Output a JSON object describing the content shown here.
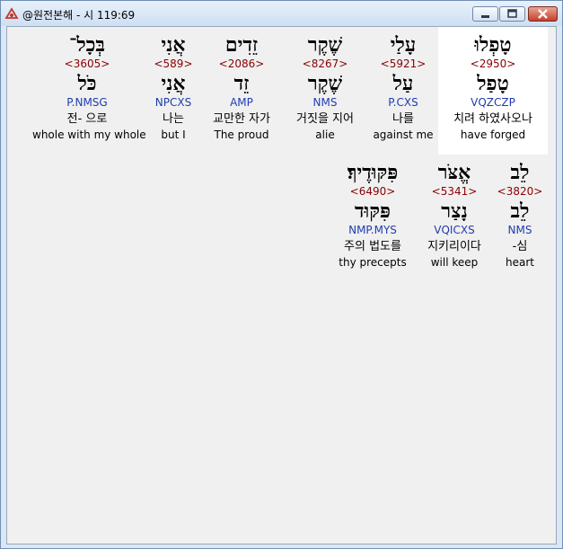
{
  "window": {
    "title": "@원전본해 - 시 119:69"
  },
  "rows": [
    [
      {
        "hebrew": "טָפְלוּ",
        "strong": "<2950>",
        "lemma": "טָפַל",
        "parsing": "VQZCZP",
        "korean": "치려 하였사오나",
        "english": "have forged",
        "selected": true
      },
      {
        "hebrew": "עָלַי",
        "strong": "<5921>",
        "lemma": "עַל",
        "parsing": "P.CXS",
        "korean": "나를",
        "english": "against me",
        "selected": false
      },
      {
        "hebrew": "שֶׁקֶר",
        "strong": "<8267>",
        "lemma": "שֶׁקֶר",
        "parsing": "NMS",
        "korean": "거짓을 지어",
        "english": "alie",
        "selected": false
      },
      {
        "hebrew": "זֵדִים",
        "strong": "<2086>",
        "lemma": "זֵד",
        "parsing": "AMP",
        "korean": "교만한 자가",
        "english": "The proud",
        "selected": false
      },
      {
        "hebrew": "אֲנִי",
        "strong": "<589>",
        "lemma": "אֲנִי",
        "parsing": "NPCXS",
        "korean": "나는",
        "english": "but I",
        "selected": false
      },
      {
        "hebrew": "בְּכָל־",
        "strong": "<3605>",
        "lemma": "כֹּל",
        "parsing": "P.NMSG",
        "korean": "전- 으로",
        "english": "whole with my whole",
        "selected": false
      }
    ],
    [
      {
        "hebrew": "לֵב",
        "strong": "<3820>",
        "lemma": "לֵב",
        "parsing": "NMS",
        "korean": "-심",
        "english": "heart",
        "selected": false
      },
      {
        "hebrew": "אֱצֹּר",
        "strong": "<5341>",
        "lemma": "נָצַר",
        "parsing": "VQICXS",
        "korean": "지키리이다",
        "english": "will keep",
        "selected": false
      },
      {
        "hebrew": "פִּקּוּדֶיךָ׃",
        "strong": "<6490>",
        "lemma": "פִּקּוּד",
        "parsing": "NMP.MYS",
        "korean": "주의 법도를",
        "english": "thy precepts",
        "selected": false
      }
    ]
  ]
}
